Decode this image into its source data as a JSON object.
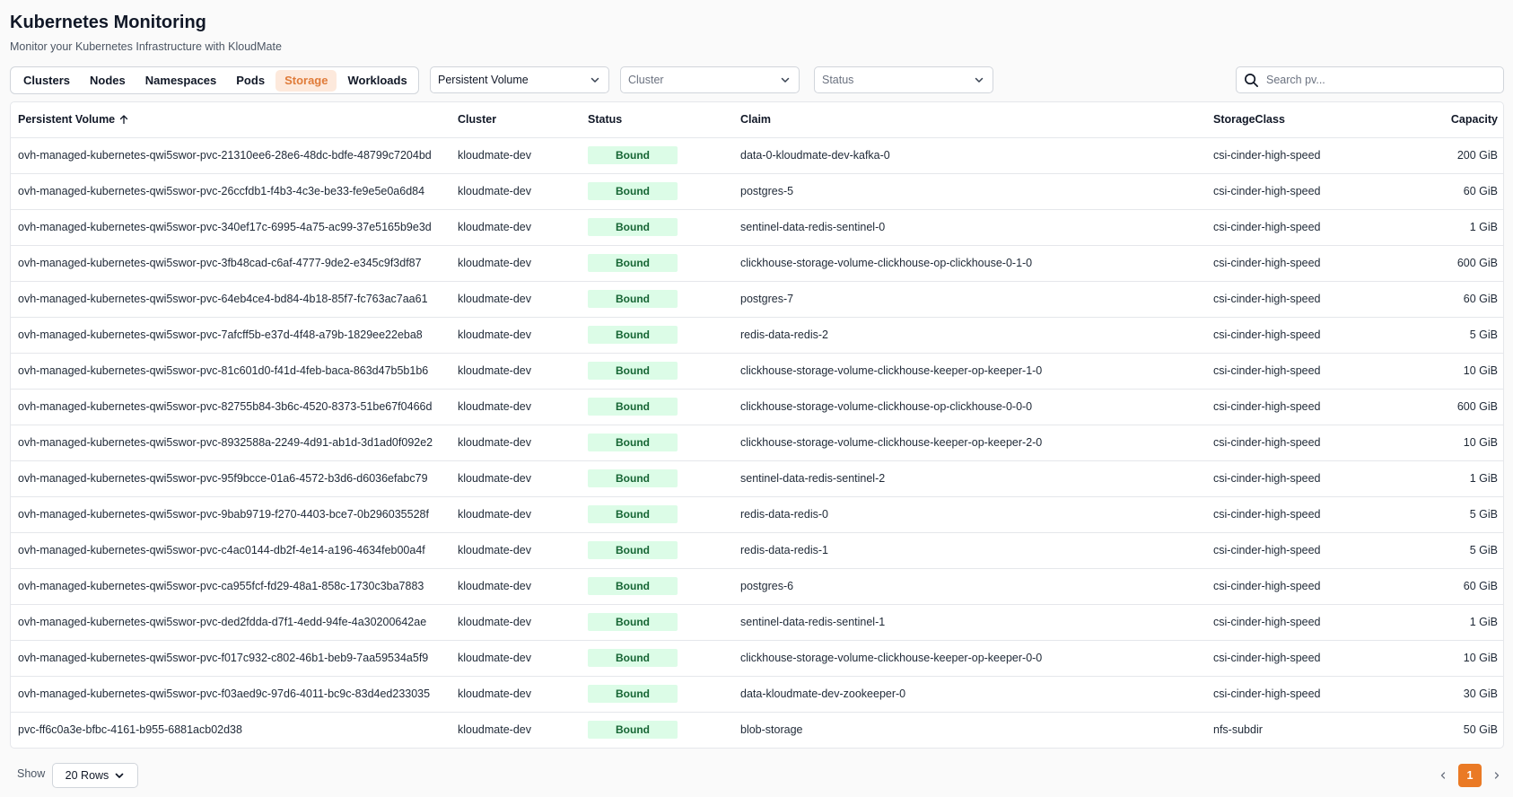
{
  "header": {
    "title": "Kubernetes Monitoring",
    "subtitle": "Monitor your Kubernetes Infrastructure with KloudMate"
  },
  "tabs": [
    {
      "label": "Clusters",
      "active": false
    },
    {
      "label": "Nodes",
      "active": false
    },
    {
      "label": "Namespaces",
      "active": false
    },
    {
      "label": "Pods",
      "active": false
    },
    {
      "label": "Storage",
      "active": true
    },
    {
      "label": "Workloads",
      "active": false
    }
  ],
  "filters": {
    "resource_type": {
      "value": "Persistent Volume"
    },
    "cluster": {
      "placeholder": "Cluster"
    },
    "status": {
      "placeholder": "Status"
    }
  },
  "search": {
    "placeholder": "Search pv..."
  },
  "table": {
    "columns": {
      "name": "Persistent Volume",
      "cluster": "Cluster",
      "status": "Status",
      "claim": "Claim",
      "storage_class": "StorageClass",
      "capacity": "Capacity"
    },
    "sort": {
      "column": "Persistent Volume",
      "direction": "ascending"
    },
    "rows": [
      {
        "name": "ovh-managed-kubernetes-qwi5swor-pvc-21310ee6-28e6-48dc-bdfe-48799c7204bd",
        "cluster": "kloudmate-dev",
        "status": "Bound",
        "claim": "data-0-kloudmate-dev-kafka-0",
        "storage_class": "csi-cinder-high-speed",
        "capacity": "200 GiB"
      },
      {
        "name": "ovh-managed-kubernetes-qwi5swor-pvc-26ccfdb1-f4b3-4c3e-be33-fe9e5e0a6d84",
        "cluster": "kloudmate-dev",
        "status": "Bound",
        "claim": "postgres-5",
        "storage_class": "csi-cinder-high-speed",
        "capacity": "60 GiB"
      },
      {
        "name": "ovh-managed-kubernetes-qwi5swor-pvc-340ef17c-6995-4a75-ac99-37e5165b9e3d",
        "cluster": "kloudmate-dev",
        "status": "Bound",
        "claim": "sentinel-data-redis-sentinel-0",
        "storage_class": "csi-cinder-high-speed",
        "capacity": "1 GiB"
      },
      {
        "name": "ovh-managed-kubernetes-qwi5swor-pvc-3fb48cad-c6af-4777-9de2-e345c9f3df87",
        "cluster": "kloudmate-dev",
        "status": "Bound",
        "claim": "clickhouse-storage-volume-clickhouse-op-clickhouse-0-1-0",
        "storage_class": "csi-cinder-high-speed",
        "capacity": "600 GiB"
      },
      {
        "name": "ovh-managed-kubernetes-qwi5swor-pvc-64eb4ce4-bd84-4b18-85f7-fc763ac7aa61",
        "cluster": "kloudmate-dev",
        "status": "Bound",
        "claim": "postgres-7",
        "storage_class": "csi-cinder-high-speed",
        "capacity": "60 GiB"
      },
      {
        "name": "ovh-managed-kubernetes-qwi5swor-pvc-7afcff5b-e37d-4f48-a79b-1829ee22eba8",
        "cluster": "kloudmate-dev",
        "status": "Bound",
        "claim": "redis-data-redis-2",
        "storage_class": "csi-cinder-high-speed",
        "capacity": "5 GiB"
      },
      {
        "name": "ovh-managed-kubernetes-qwi5swor-pvc-81c601d0-f41d-4feb-baca-863d47b5b1b6",
        "cluster": "kloudmate-dev",
        "status": "Bound",
        "claim": "clickhouse-storage-volume-clickhouse-keeper-op-keeper-1-0",
        "storage_class": "csi-cinder-high-speed",
        "capacity": "10 GiB"
      },
      {
        "name": "ovh-managed-kubernetes-qwi5swor-pvc-82755b84-3b6c-4520-8373-51be67f0466d",
        "cluster": "kloudmate-dev",
        "status": "Bound",
        "claim": "clickhouse-storage-volume-clickhouse-op-clickhouse-0-0-0",
        "storage_class": "csi-cinder-high-speed",
        "capacity": "600 GiB"
      },
      {
        "name": "ovh-managed-kubernetes-qwi5swor-pvc-8932588a-2249-4d91-ab1d-3d1ad0f092e2",
        "cluster": "kloudmate-dev",
        "status": "Bound",
        "claim": "clickhouse-storage-volume-clickhouse-keeper-op-keeper-2-0",
        "storage_class": "csi-cinder-high-speed",
        "capacity": "10 GiB"
      },
      {
        "name": "ovh-managed-kubernetes-qwi5swor-pvc-95f9bcce-01a6-4572-b3d6-d6036efabc79",
        "cluster": "kloudmate-dev",
        "status": "Bound",
        "claim": "sentinel-data-redis-sentinel-2",
        "storage_class": "csi-cinder-high-speed",
        "capacity": "1 GiB"
      },
      {
        "name": "ovh-managed-kubernetes-qwi5swor-pvc-9bab9719-f270-4403-bce7-0b296035528f",
        "cluster": "kloudmate-dev",
        "status": "Bound",
        "claim": "redis-data-redis-0",
        "storage_class": "csi-cinder-high-speed",
        "capacity": "5 GiB"
      },
      {
        "name": "ovh-managed-kubernetes-qwi5swor-pvc-c4ac0144-db2f-4e14-a196-4634feb00a4f",
        "cluster": "kloudmate-dev",
        "status": "Bound",
        "claim": "redis-data-redis-1",
        "storage_class": "csi-cinder-high-speed",
        "capacity": "5 GiB"
      },
      {
        "name": "ovh-managed-kubernetes-qwi5swor-pvc-ca955fcf-fd29-48a1-858c-1730c3ba7883",
        "cluster": "kloudmate-dev",
        "status": "Bound",
        "claim": "postgres-6",
        "storage_class": "csi-cinder-high-speed",
        "capacity": "60 GiB"
      },
      {
        "name": "ovh-managed-kubernetes-qwi5swor-pvc-ded2fdda-d7f1-4edd-94fe-4a30200642ae",
        "cluster": "kloudmate-dev",
        "status": "Bound",
        "claim": "sentinel-data-redis-sentinel-1",
        "storage_class": "csi-cinder-high-speed",
        "capacity": "1 GiB"
      },
      {
        "name": "ovh-managed-kubernetes-qwi5swor-pvc-f017c932-c802-46b1-beb9-7aa59534a5f9",
        "cluster": "kloudmate-dev",
        "status": "Bound",
        "claim": "clickhouse-storage-volume-clickhouse-keeper-op-keeper-0-0",
        "storage_class": "csi-cinder-high-speed",
        "capacity": "10 GiB"
      },
      {
        "name": "ovh-managed-kubernetes-qwi5swor-pvc-f03aed9c-97d6-4011-bc9c-83d4ed233035",
        "cluster": "kloudmate-dev",
        "status": "Bound",
        "claim": "data-kloudmate-dev-zookeeper-0",
        "storage_class": "csi-cinder-high-speed",
        "capacity": "30 GiB"
      },
      {
        "name": "pvc-ff6c0a3e-bfbc-4161-b955-6881acb02d38",
        "cluster": "kloudmate-dev",
        "status": "Bound",
        "claim": "blob-storage",
        "storage_class": "nfs-subdir",
        "capacity": "50 GiB"
      }
    ]
  },
  "footer": {
    "show_label": "Show",
    "rows_per_page": "20 Rows",
    "current_page": "1"
  },
  "colors": {
    "accent": "#ea7a25",
    "active_tab_bg": "#fde9dc",
    "active_tab_text": "#e07b39",
    "status_bound_bg": "#dcfce7",
    "status_bound_text": "#166534"
  },
  "icons": {
    "sort": "arrow-up-icon",
    "dropdown": "chevron-down-icon",
    "search": "search-icon",
    "prev": "chevron-left-icon",
    "next": "chevron-right-icon"
  }
}
